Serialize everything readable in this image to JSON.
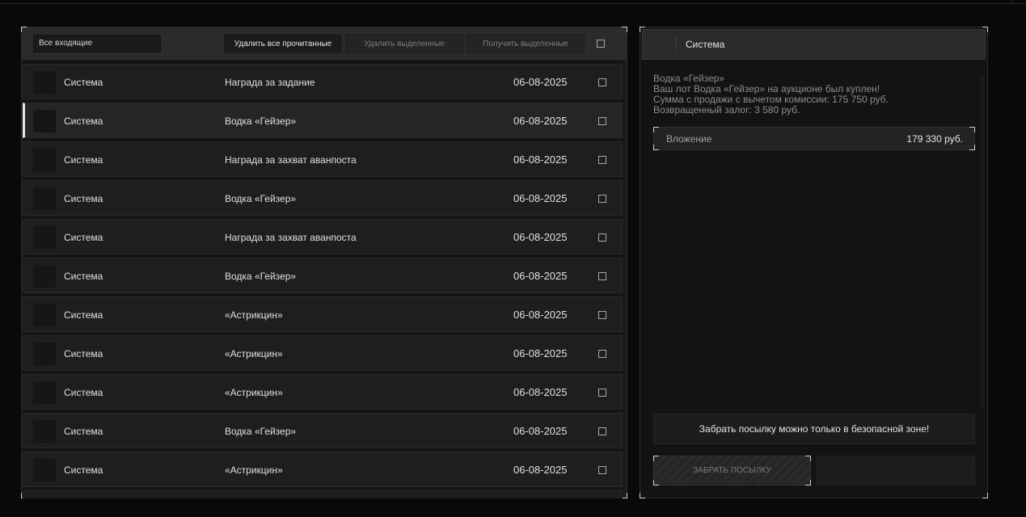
{
  "toolbar": {
    "filter_value": "Все входящие",
    "delete_read_label": "Удалить все прочитанные",
    "delete_selected_label": "Удалить выделенные",
    "receive_selected_label": "Получить выделенные"
  },
  "mail_list": [
    {
      "sender": "Система",
      "subject": "Награда за задание",
      "date": "06-08-2025"
    },
    {
      "sender": "Система",
      "subject": "Водка «Гейзер»",
      "date": "06-08-2025"
    },
    {
      "sender": "Система",
      "subject": "Награда за захват аванпоста",
      "date": "06-08-2025"
    },
    {
      "sender": "Система",
      "subject": "Водка «Гейзер»",
      "date": "06-08-2025"
    },
    {
      "sender": "Система",
      "subject": "Награда за захват аванпоста",
      "date": "06-08-2025"
    },
    {
      "sender": "Система",
      "subject": "Водка «Гейзер»",
      "date": "06-08-2025"
    },
    {
      "sender": "Система",
      "subject": "«Астрикцин»",
      "date": "06-08-2025"
    },
    {
      "sender": "Система",
      "subject": "«Астрикцин»",
      "date": "06-08-2025"
    },
    {
      "sender": "Система",
      "subject": "«Астрикцин»",
      "date": "06-08-2025"
    },
    {
      "sender": "Система",
      "subject": "Водка «Гейзер»",
      "date": "06-08-2025"
    },
    {
      "sender": "Система",
      "subject": "«Астрикцин»",
      "date": "06-08-2025"
    }
  ],
  "message": {
    "sender": "Система",
    "lines": [
      "Водка «Гейзер»",
      "Ваш лот Водка «Гейзер» на аукционе был куплен!",
      "Сумма с продажи с вычетом комиссии: 175 750 руб.",
      "Возвращенный залог: 3 580 руб."
    ],
    "attachment_label": "Вложение",
    "attachment_value": "179 330 руб.",
    "notice": "Забрать посылку можно только в безопасной зоне!",
    "take_button_label": "ЗАБРАТЬ ПОСЫЛКУ"
  },
  "colors": {
    "background": "#0b0908",
    "panel": "#141414",
    "row": "#1e1e1e",
    "selected_marker": "#e6e6e6",
    "text": "#e0e0e0",
    "muted_text": "#8e8e8e"
  }
}
